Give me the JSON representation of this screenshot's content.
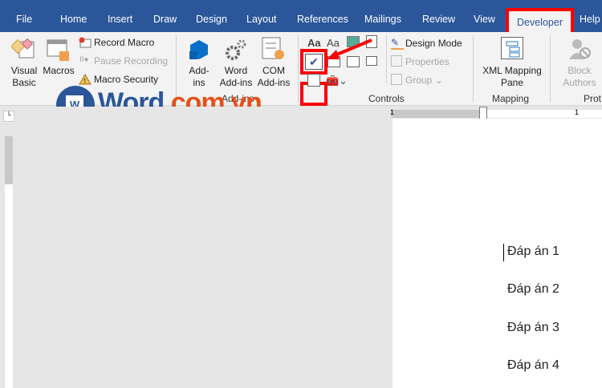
{
  "tabs": [
    "File",
    "Home",
    "Insert",
    "Draw",
    "Design",
    "Layout",
    "References",
    "Mailings",
    "Review",
    "View",
    "Developer",
    "Help"
  ],
  "code": {
    "visual_basic": "Visual Basic",
    "macros": "Macros",
    "record_macro": "Record Macro",
    "pause_recording": "Pause Recording",
    "macro_security": "Macro Security"
  },
  "addins": {
    "addins": "Add-ins",
    "word_addins": "Word Add-ins",
    "com_addins": "COM Add-ins",
    "group": "Add-ins"
  },
  "controls": {
    "design_mode": "Design Mode",
    "properties": "Properties",
    "group_btn": "Group",
    "group": "Controls",
    "aa1": "Aa",
    "aa2": "Aa"
  },
  "mapping": {
    "xml": "XML Mapping Pane",
    "group": "Mapping"
  },
  "protect": {
    "block": "Block Authors",
    "group": "Prot"
  },
  "watermark": {
    "word": "Word",
    ".com.vn": ".com.vn"
  },
  "ruler": {
    "n1": "1",
    "n2": "1"
  },
  "document": {
    "lines": [
      "Đáp án 1",
      "Đáp án 2",
      "Đáp án 3",
      "Đáp án 4"
    ]
  },
  "colors": {
    "accent": "#2b579a",
    "highlight": "#ff0000"
  }
}
